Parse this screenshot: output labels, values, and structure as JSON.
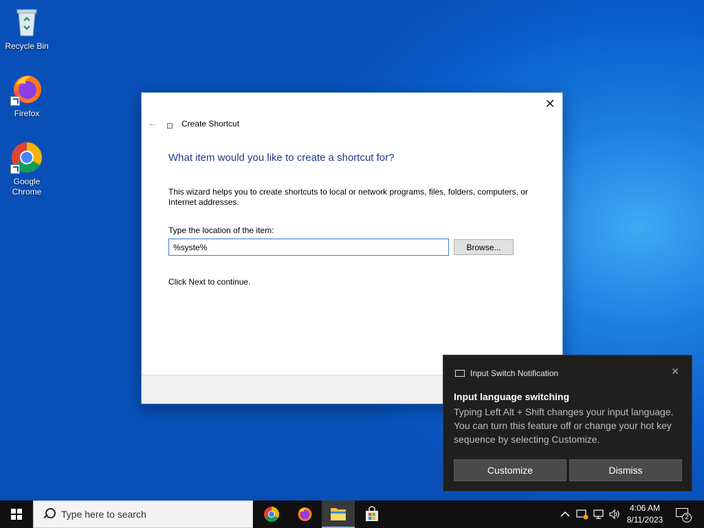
{
  "desktop": {
    "icons": [
      {
        "label": "Recycle Bin"
      },
      {
        "label": "Firefox"
      },
      {
        "label": "Google Chrome"
      }
    ]
  },
  "dialog": {
    "window_title": "Create Shortcut",
    "heading": "What item would you like to create a shortcut for?",
    "description": "This wizard helps you to create shortcuts to local or network programs, files, folders, computers, or Internet addresses.",
    "location_label": "Type the location of the item:",
    "location_value": "%syste%",
    "browse_label": "Browse...",
    "continue_text": "Click Next to continue.",
    "close_glyph": "✕",
    "back_glyph": "←"
  },
  "toast": {
    "app_name": "Input Switch Notification",
    "title": "Input language switching",
    "body": "Typing Left Alt + Shift changes your input language. You can turn this feature off or change your hot key sequence by selecting Customize.",
    "customize_label": "Customize",
    "dismiss_label": "Dismiss",
    "close_glyph": "✕"
  },
  "taskbar": {
    "search_placeholder": "Type here to search",
    "apps": [
      "chrome",
      "firefox",
      "file-explorer",
      "microsoft-store"
    ],
    "tray_chevron": "^",
    "clock_time": "4:06 AM",
    "clock_date": "8/11/2023",
    "notification_count": "2"
  },
  "colors": {
    "heading_blue": "#1e3a8a",
    "input_border": "#3a7bd5",
    "toast_bg": "#1f1f1f",
    "taskbar_bg": "#101010"
  }
}
